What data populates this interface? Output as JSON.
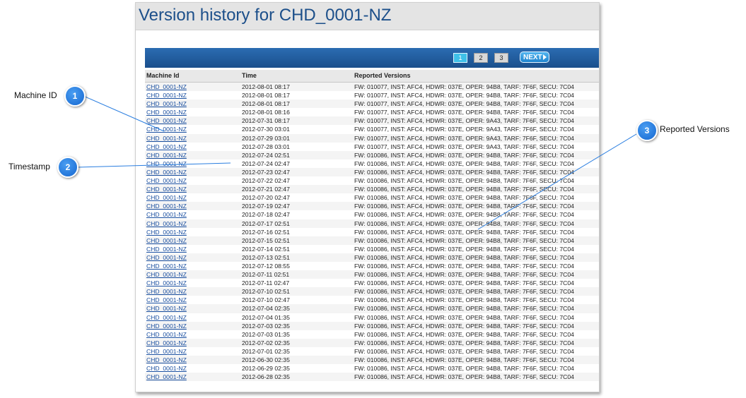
{
  "page_title": "Version history for CHD_0001-NZ",
  "pagination": {
    "pages": [
      "1",
      "2",
      "3"
    ],
    "active": "1",
    "next_label": "NEXT"
  },
  "table": {
    "columns": [
      "Machine Id",
      "Time",
      "Reported Versions"
    ],
    "rows": [
      {
        "id": "CHD_0001-NZ",
        "time": "2012-08-01 08:17",
        "versions": "FW: 010077, INST: AFC4, HDWR: 037E, OPER: 94B8, TARF: 7F6F, SECU: 7C04"
      },
      {
        "id": "CHD_0001-NZ",
        "time": "2012-08-01 08:17",
        "versions": "FW: 010077, INST: AFC4, HDWR: 037E, OPER: 94B8, TARF: 7F6F, SECU: 7C04"
      },
      {
        "id": "CHD_0001-NZ",
        "time": "2012-08-01 08:17",
        "versions": "FW: 010077, INST: AFC4, HDWR: 037E, OPER: 94B8, TARF: 7F6F, SECU: 7C04"
      },
      {
        "id": "CHD_0001-NZ",
        "time": "2012-08-01 08:16",
        "versions": "FW: 010077, INST: AFC4, HDWR: 037E, OPER: 94B8, TARF: 7F6F, SECU: 7C04"
      },
      {
        "id": "CHD_0001-NZ",
        "time": "2012-07-31 08:17",
        "versions": "FW: 010077, INST: AFC4, HDWR: 037E, OPER: 9A43, TARF: 7F6F, SECU: 7C04"
      },
      {
        "id": "CHD_0001-NZ",
        "time": "2012-07-30 03:01",
        "versions": "FW: 010077, INST: AFC4, HDWR: 037E, OPER: 9A43, TARF: 7F6F, SECU: 7C04"
      },
      {
        "id": "CHD_0001-NZ",
        "time": "2012-07-29 03:01",
        "versions": "FW: 010077, INST: AFC4, HDWR: 037E, OPER: 9A43, TARF: 7F6F, SECU: 7C04"
      },
      {
        "id": "CHD_0001-NZ",
        "time": "2012-07-28 03:01",
        "versions": "FW: 010077, INST: AFC4, HDWR: 037E, OPER: 9A43, TARF: 7F6F, SECU: 7C04"
      },
      {
        "id": "CHD_0001-NZ",
        "time": "2012-07-24 02:51",
        "versions": "FW: 010086, INST: AFC4, HDWR: 037E, OPER: 94B8, TARF: 7F6F, SECU: 7C04"
      },
      {
        "id": "CHD_0001-NZ",
        "time": "2012-07-24 02:47",
        "versions": "FW: 010086, INST: AFC4, HDWR: 037E, OPER: 94B8, TARF: 7F6F, SECU: 7C04"
      },
      {
        "id": "CHD_0001-NZ",
        "time": "2012-07-23 02:47",
        "versions": "FW: 010086, INST: AFC4, HDWR: 037E, OPER: 94B8, TARF: 7F6F, SECU: 7C04"
      },
      {
        "id": "CHD_0001-NZ",
        "time": "2012-07-22 02:47",
        "versions": "FW: 010086, INST: AFC4, HDWR: 037E, OPER: 94B8, TARF: 7F6F, SECU: 7C04"
      },
      {
        "id": "CHD_0001-NZ",
        "time": "2012-07-21 02:47",
        "versions": "FW: 010086, INST: AFC4, HDWR: 037E, OPER: 94B8, TARF: 7F6F, SECU: 7C04"
      },
      {
        "id": "CHD_0001-NZ",
        "time": "2012-07-20 02:47",
        "versions": "FW: 010086, INST: AFC4, HDWR: 037E, OPER: 94B8, TARF: 7F6F, SECU: 7C04"
      },
      {
        "id": "CHD_0001-NZ",
        "time": "2012-07-19 02:47",
        "versions": "FW: 010086, INST: AFC4, HDWR: 037E, OPER: 94B8, TARF: 7F6F, SECU: 7C04"
      },
      {
        "id": "CHD_0001-NZ",
        "time": "2012-07-18 02:47",
        "versions": "FW: 010086, INST: AFC4, HDWR: 037E, OPER: 94B8, TARF: 7F6F, SECU: 7C04"
      },
      {
        "id": "CHD_0001-NZ",
        "time": "2012-07-17 02:51",
        "versions": "FW: 010086, INST: AFC4, HDWR: 037E, OPER: 94B8, TARF: 7F6F, SECU: 7C04"
      },
      {
        "id": "CHD_0001-NZ",
        "time": "2012-07-16 02:51",
        "versions": "FW: 010086, INST: AFC4, HDWR: 037E, OPER: 94B8, TARF: 7F6F, SECU: 7C04"
      },
      {
        "id": "CHD_0001-NZ",
        "time": "2012-07-15 02:51",
        "versions": "FW: 010086, INST: AFC4, HDWR: 037E, OPER: 94B8, TARF: 7F6F, SECU: 7C04"
      },
      {
        "id": "CHD_0001-NZ",
        "time": "2012-07-14 02:51",
        "versions": "FW: 010086, INST: AFC4, HDWR: 037E, OPER: 94B8, TARF: 7F6F, SECU: 7C04"
      },
      {
        "id": "CHD_0001-NZ",
        "time": "2012-07-13 02:51",
        "versions": "FW: 010086, INST: AFC4, HDWR: 037E, OPER: 94B8, TARF: 7F6F, SECU: 7C04"
      },
      {
        "id": "CHD_0001-NZ",
        "time": "2012-07-12 08:55",
        "versions": "FW: 010086, INST: AFC4, HDWR: 037E, OPER: 94B8, TARF: 7F6F, SECU: 7C04"
      },
      {
        "id": "CHD_0001-NZ",
        "time": "2012-07-11 02:51",
        "versions": "FW: 010086, INST: AFC4, HDWR: 037E, OPER: 94B8, TARF: 7F6F, SECU: 7C04"
      },
      {
        "id": "CHD_0001-NZ",
        "time": "2012-07-11 02:47",
        "versions": "FW: 010086, INST: AFC4, HDWR: 037E, OPER: 94B8, TARF: 7F6F, SECU: 7C04"
      },
      {
        "id": "CHD_0001-NZ",
        "time": "2012-07-10 02:51",
        "versions": "FW: 010086, INST: AFC4, HDWR: 037E, OPER: 94B8, TARF: 7F6F, SECU: 7C04"
      },
      {
        "id": "CHD_0001-NZ",
        "time": "2012-07-10 02:47",
        "versions": "FW: 010086, INST: AFC4, HDWR: 037E, OPER: 94B8, TARF: 7F6F, SECU: 7C04"
      },
      {
        "id": "CHD_0001-NZ",
        "time": "2012-07-04 02:35",
        "versions": "FW: 010086, INST: AFC4, HDWR: 037E, OPER: 94B8, TARF: 7F6F, SECU: 7C04"
      },
      {
        "id": "CHD_0001-NZ",
        "time": "2012-07-04 01:35",
        "versions": "FW: 010086, INST: AFC4, HDWR: 037E, OPER: 94B8, TARF: 7F6F, SECU: 7C04"
      },
      {
        "id": "CHD_0001-NZ",
        "time": "2012-07-03 02:35",
        "versions": "FW: 010086, INST: AFC4, HDWR: 037E, OPER: 94B8, TARF: 7F6F, SECU: 7C04"
      },
      {
        "id": "CHD_0001-NZ",
        "time": "2012-07-03 01:35",
        "versions": "FW: 010086, INST: AFC4, HDWR: 037E, OPER: 94B8, TARF: 7F6F, SECU: 7C04"
      },
      {
        "id": "CHD_0001-NZ",
        "time": "2012-07-02 02:35",
        "versions": "FW: 010086, INST: AFC4, HDWR: 037E, OPER: 94B8, TARF: 7F6F, SECU: 7C04"
      },
      {
        "id": "CHD_0001-NZ",
        "time": "2012-07-01 02:35",
        "versions": "FW: 010086, INST: AFC4, HDWR: 037E, OPER: 94B8, TARF: 7F6F, SECU: 7C04"
      },
      {
        "id": "CHD_0001-NZ",
        "time": "2012-06-30 02:35",
        "versions": "FW: 010086, INST: AFC4, HDWR: 037E, OPER: 94B8, TARF: 7F6F, SECU: 7C04"
      },
      {
        "id": "CHD_0001-NZ",
        "time": "2012-06-29 02:35",
        "versions": "FW: 010086, INST: AFC4, HDWR: 037E, OPER: 94B8, TARF: 7F6F, SECU: 7C04"
      },
      {
        "id": "CHD_0001-NZ",
        "time": "2012-06-28 02:35",
        "versions": "FW: 010086, INST: AFC4, HDWR: 037E, OPER: 94B8, TARF: 7F6F, SECU: 7C04"
      }
    ]
  },
  "callouts": [
    {
      "number": "1",
      "label": "Machine ID"
    },
    {
      "number": "2",
      "label": "Timestamp"
    },
    {
      "number": "3",
      "label": "Reported Versions"
    }
  ],
  "colors": {
    "title": "#1c4f8a",
    "nav_bar": "#1f5c9e",
    "link": "#1a4fa0",
    "callout": "#1e74d8"
  }
}
